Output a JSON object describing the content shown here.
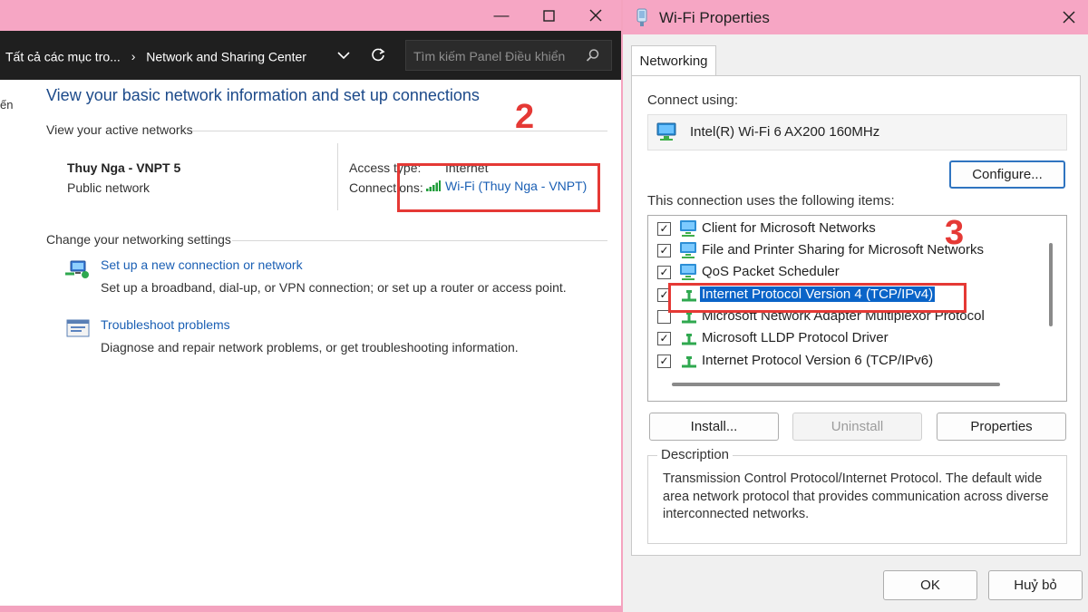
{
  "left": {
    "breadcrumb": [
      "Tất cả các mục tro...",
      "Network and Sharing Center"
    ],
    "search_placeholder": "Tìm kiếm Panel Điều khiển",
    "cut_label": "ến",
    "page_title": "View your basic network information and set up connections",
    "active_networks_label": "View your active networks",
    "network_name": "Thuy Nga - VNPT 5",
    "network_type": "Public network",
    "access_type_label": "Access type:",
    "access_type_value": "Internet",
    "connections_label": "Connections:",
    "connection_link": "Wi-Fi (Thuy Nga - VNPT)",
    "change_settings_label": "Change your networking settings",
    "tasks": [
      {
        "link": "Set up a new connection or network",
        "desc": "Set up a broadband, dial-up, or VPN connection; or set up a router or access point."
      },
      {
        "link": "Troubleshoot problems",
        "desc": "Diagnose and repair network problems, or get troubleshooting information."
      }
    ],
    "annotation": "2"
  },
  "dialog": {
    "title": "Wi-Fi Properties",
    "tab": "Networking",
    "connect_using_label": "Connect using:",
    "adapter": "Intel(R) Wi-Fi 6 AX200 160MHz",
    "configure_label": "Configure...",
    "items_label": "This connection uses the following items:",
    "items": [
      {
        "label": "Client for Microsoft Networks",
        "checked": true,
        "icon": "network-client-icon"
      },
      {
        "label": "File and Printer Sharing for Microsoft Networks",
        "checked": true,
        "icon": "file-sharing-icon"
      },
      {
        "label": "QoS Packet Scheduler",
        "checked": true,
        "icon": "qos-icon"
      },
      {
        "label": "Internet Protocol Version 4 (TCP/IPv4)",
        "checked": true,
        "selected": true,
        "icon": "protocol-icon"
      },
      {
        "label": "Microsoft Network Adapter Multiplexor Protocol",
        "checked": false,
        "icon": "protocol-icon"
      },
      {
        "label": "Microsoft LLDP Protocol Driver",
        "checked": true,
        "icon": "protocol-icon"
      },
      {
        "label": "Internet Protocol Version 6 (TCP/IPv6)",
        "checked": true,
        "icon": "protocol-icon"
      }
    ],
    "install_label": "Install...",
    "uninstall_label": "Uninstall",
    "properties_label": "Properties",
    "description_label": "Description",
    "description_text": "Transmission Control Protocol/Internet Protocol. The default wide area network protocol that provides communication across diverse interconnected networks.",
    "ok_label": "OK",
    "cancel_label": "Huỷ bỏ",
    "annotation": "3"
  },
  "colors": {
    "titlebar": "#f6a6c4",
    "annotation_red": "#e53935",
    "link_blue": "#1a5fb4",
    "selection_blue": "#0a64c8"
  }
}
